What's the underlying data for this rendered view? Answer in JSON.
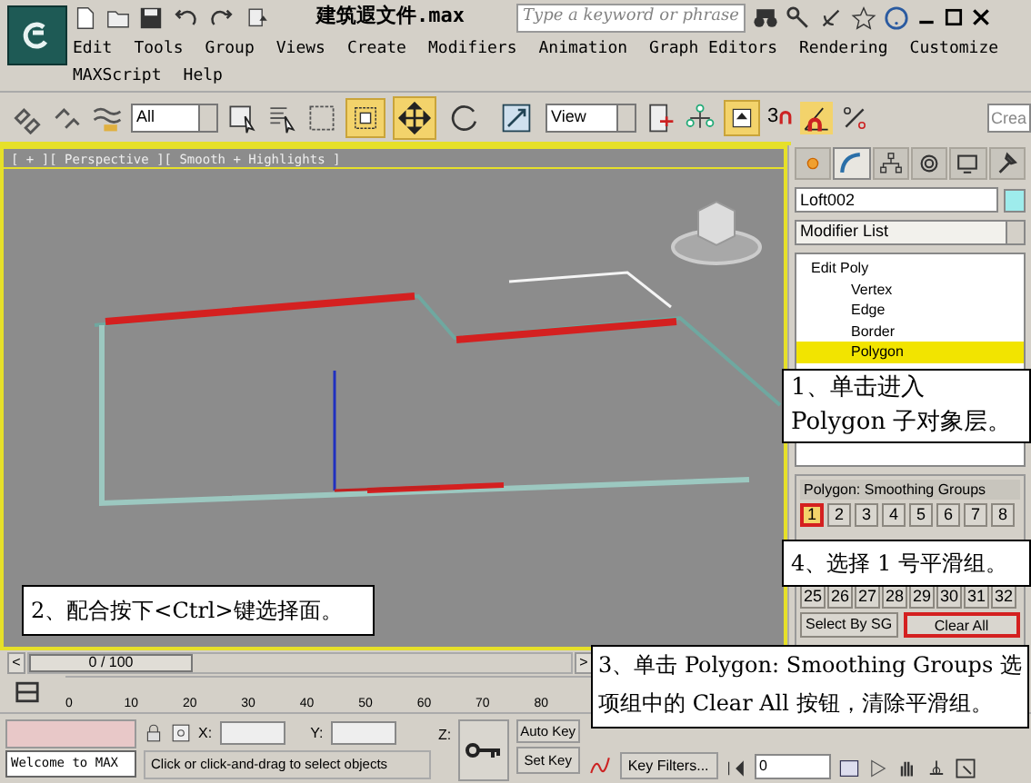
{
  "title_bar": {
    "file_name": "建筑遐文件.max",
    "search_placeholder": "Type a keyword or phrase"
  },
  "menu": [
    "Edit",
    "Tools",
    "Group",
    "Views",
    "Create",
    "Modifiers",
    "Animation",
    "Graph Editors",
    "Rendering",
    "Customize",
    "MAXScript",
    "Help"
  ],
  "toolbar": {
    "selection_filter": "All",
    "reference_coordinate": "View",
    "snap_label": "3",
    "named_selection": "Crea",
    "tools": [
      {
        "kind": "move",
        "selected": true
      },
      {
        "kind": "rotate",
        "selected": false
      },
      {
        "kind": "scale",
        "selected": false
      }
    ]
  },
  "viewport": {
    "label": "[ + ][ Perspective ][ Smooth + Highlights ]",
    "active": true
  },
  "command_panel": {
    "tabs": [
      {
        "kind": "create",
        "selected": false
      },
      {
        "kind": "modify",
        "selected": true
      },
      {
        "kind": "hierarchy",
        "selected": false
      },
      {
        "kind": "motion",
        "selected": false
      },
      {
        "kind": "display",
        "selected": false
      },
      {
        "kind": "utilities",
        "selected": false
      }
    ],
    "object_name": "Loft002",
    "modifier_list": "Modifier List",
    "stack": [
      {
        "label": "Edit Poly",
        "kind": "modifier",
        "selected": false
      },
      {
        "label": "Vertex",
        "kind": "sub",
        "selected": false
      },
      {
        "label": "Edge",
        "kind": "sub",
        "selected": false
      },
      {
        "label": "Border",
        "kind": "sub",
        "selected": false
      },
      {
        "label": "Polygon",
        "kind": "sub",
        "selected": true
      }
    ],
    "rollout_title": "Polygon: Smoothing Groups",
    "groups_top": [
      {
        "label": "1",
        "selected": true
      },
      {
        "label": "2",
        "selected": false
      },
      {
        "label": "3",
        "selected": false
      },
      {
        "label": "4",
        "selected": false
      },
      {
        "label": "5",
        "selected": false
      },
      {
        "label": "6",
        "selected": false
      },
      {
        "label": "7",
        "selected": false
      },
      {
        "label": "8",
        "selected": false
      }
    ],
    "groups_bottom": [
      {
        "label": "25",
        "selected": false
      },
      {
        "label": "26",
        "selected": false
      },
      {
        "label": "27",
        "selected": false
      },
      {
        "label": "28",
        "selected": false
      },
      {
        "label": "29",
        "selected": false
      },
      {
        "label": "30",
        "selected": false
      },
      {
        "label": "31",
        "selected": false
      },
      {
        "label": "32",
        "selected": false
      }
    ],
    "select_by_sg": "Select By SG",
    "clear_all": "Clear All"
  },
  "time_slider": {
    "prev": "<",
    "position": "0 / 100",
    "next": ">",
    "level": 0
  },
  "track_ticks": [
    "0",
    "10",
    "20",
    "30",
    "40",
    "50",
    "60",
    "70",
    "80"
  ],
  "status": {
    "welcome": "Welcome to MAX",
    "prompt": "Click or click-and-drag to select objects",
    "x_label": "X:",
    "y_label": "Y:",
    "z_label": "Z:",
    "auto_key": "Auto Key",
    "set_key": "Set Key",
    "key_filters": "Key Filters...",
    "frame": "0"
  },
  "callouts": [
    {
      "text": "1、单击进入 Polygon 子对象层。",
      "kind": "stack"
    },
    {
      "text": "4、选择 1 号平滑组。",
      "kind": "groups"
    },
    {
      "text": "2、配合按下<Ctrl>键选择面。",
      "kind": "viewport"
    },
    {
      "text": "3、单击 Polygon: Smoothing Groups 选项组中的 Clear All 按钮，清除平滑组。",
      "kind": "bottom"
    }
  ]
}
